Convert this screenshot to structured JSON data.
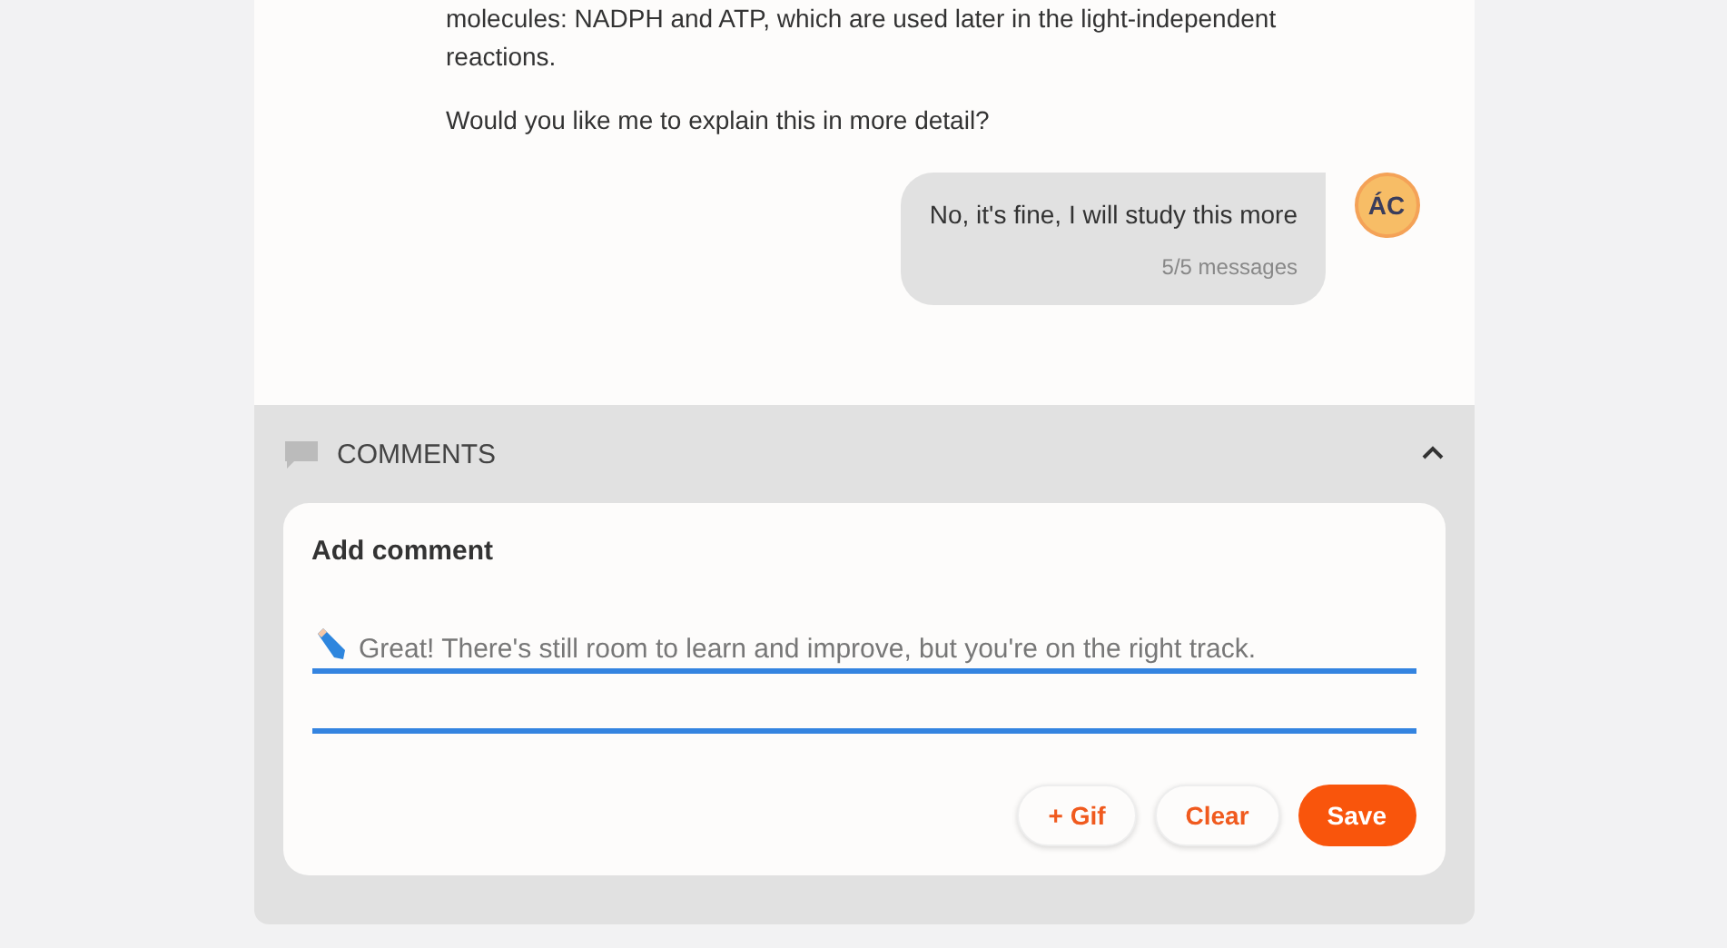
{
  "assistant_message": {
    "paragraphs": [
      "molecules: NADPH and ATP, which are used later in the light-independent reactions.",
      "Would you like me to explain this in more detail?"
    ]
  },
  "user_message": {
    "text": "No, it's fine, I will study this more",
    "counter": "5/5 messages",
    "avatar_initials": "ÁC"
  },
  "comments": {
    "title": "COMMENTS",
    "expanded": true,
    "form_title": "Add comment",
    "value": "Great! There's still room to learn and improve, but you're on the right track.",
    "buttons": [
      {
        "label": "+ Gif",
        "kind": "secondary"
      },
      {
        "label": "Clear",
        "kind": "secondary"
      },
      {
        "label": "Save",
        "kind": "primary"
      }
    ]
  }
}
